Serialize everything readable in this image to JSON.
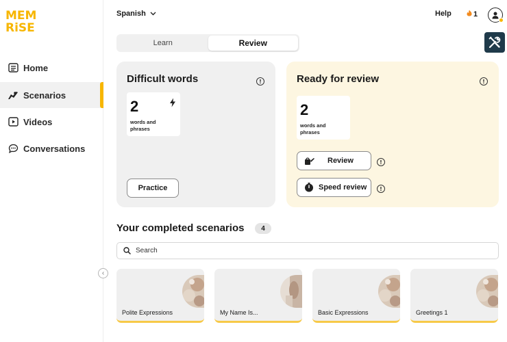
{
  "brand": {
    "logo_line1": "MEM",
    "logo_line2": "RiSE",
    "color": "#f7b600"
  },
  "sidebar": {
    "items": [
      {
        "label": "Home",
        "icon": "home-icon"
      },
      {
        "label": "Scenarios",
        "icon": "scenarios-icon",
        "active": true
      },
      {
        "label": "Videos",
        "icon": "video-icon"
      },
      {
        "label": "Conversations",
        "icon": "chat-icon"
      }
    ]
  },
  "topbar": {
    "language": "Spanish",
    "help": "Help",
    "streak": "1"
  },
  "tabs": [
    {
      "label": "Learn"
    },
    {
      "label": "Review",
      "active": true
    }
  ],
  "difficult": {
    "title": "Difficult words",
    "count": "2",
    "count_label": "words and phrases",
    "practice_button": "Practice"
  },
  "ready": {
    "title": "Ready for review",
    "count": "2",
    "count_label": "words and phrases",
    "review_button": "Review",
    "speed_button": "Speed review"
  },
  "completed": {
    "title": "Your completed scenarios",
    "count": "4",
    "search_placeholder": "Search",
    "scenarios": [
      {
        "label": "Polite Expressions"
      },
      {
        "label": "My Name Is..."
      },
      {
        "label": "Basic Expressions"
      },
      {
        "label": "Greetings 1"
      }
    ]
  },
  "colors": {
    "accent": "#f7b600",
    "review_card_bg": "#fdf6e1",
    "neutral_card_bg": "#f0f0f0",
    "tools_bg": "#1f3a4a"
  }
}
